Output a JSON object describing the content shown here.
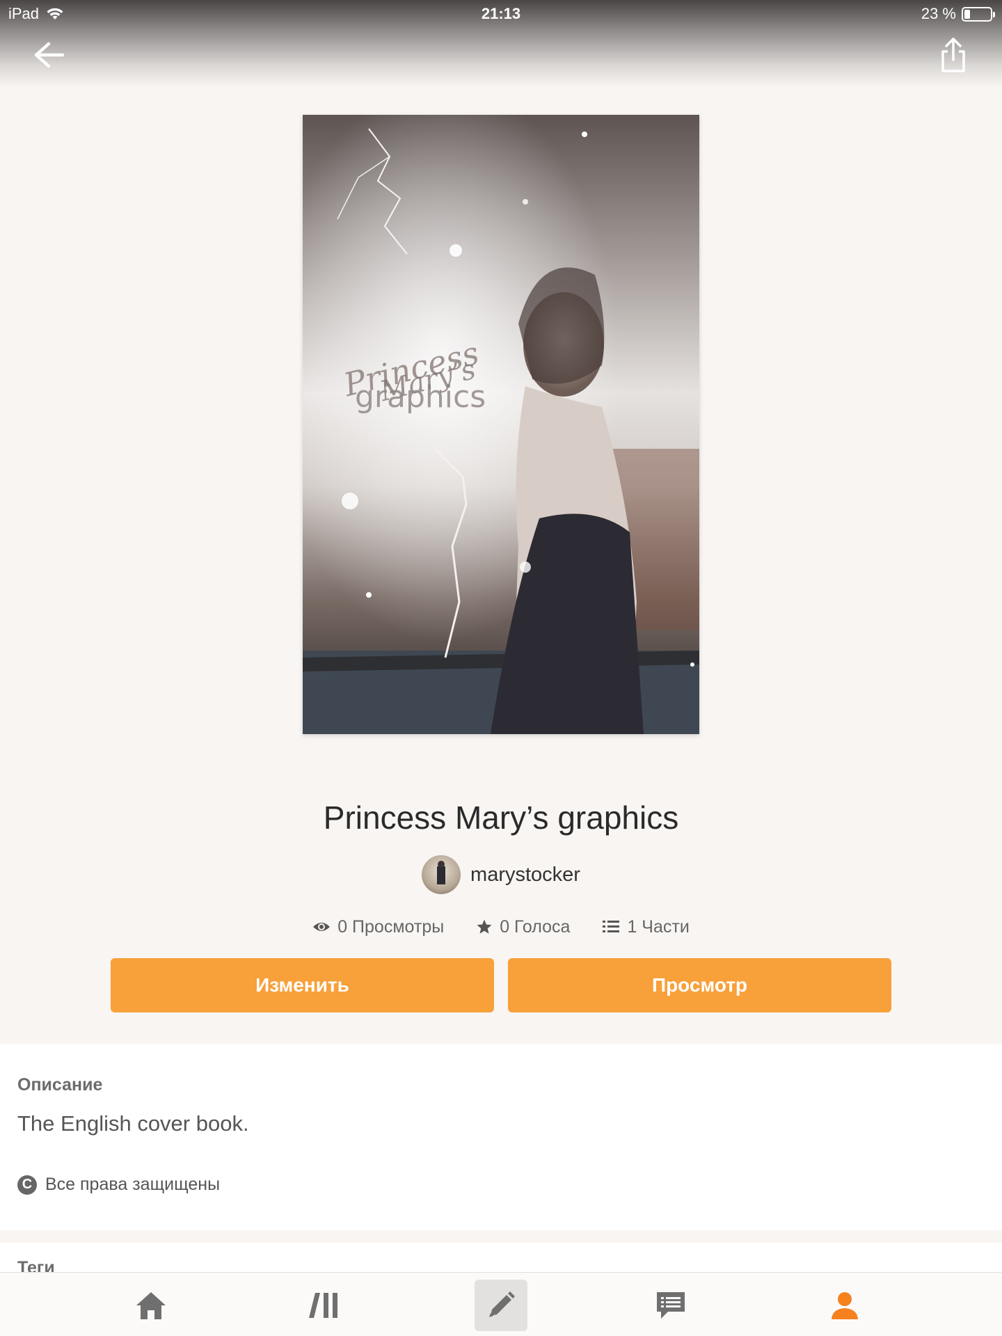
{
  "status_bar": {
    "device": "iPad",
    "time": "21:13",
    "battery_text": "23 %",
    "battery_level": 0.23
  },
  "story": {
    "title": "Princess Mary’s graphics",
    "author": "marystocker",
    "cover_text": [
      "Princess",
      "Mary’s",
      "graphics"
    ]
  },
  "stats": {
    "views": "0 Просмотры",
    "votes": "0 Голоса",
    "parts": "1 Части"
  },
  "buttons": {
    "edit": "Изменить",
    "view": "Просмотр"
  },
  "description": {
    "heading": "Описание",
    "text": "The English cover book.",
    "rights": "Все права защищены"
  },
  "tags": {
    "heading": "Теги"
  },
  "tabbar": {
    "items": [
      "home-icon",
      "library-icon",
      "write-icon",
      "messages-icon",
      "profile-icon"
    ],
    "active": "write-icon",
    "active_color": "#f5811f",
    "inactive_color": "#6f6f6f"
  },
  "colors": {
    "accent": "#f8a03a",
    "background": "#f8f5f2"
  }
}
